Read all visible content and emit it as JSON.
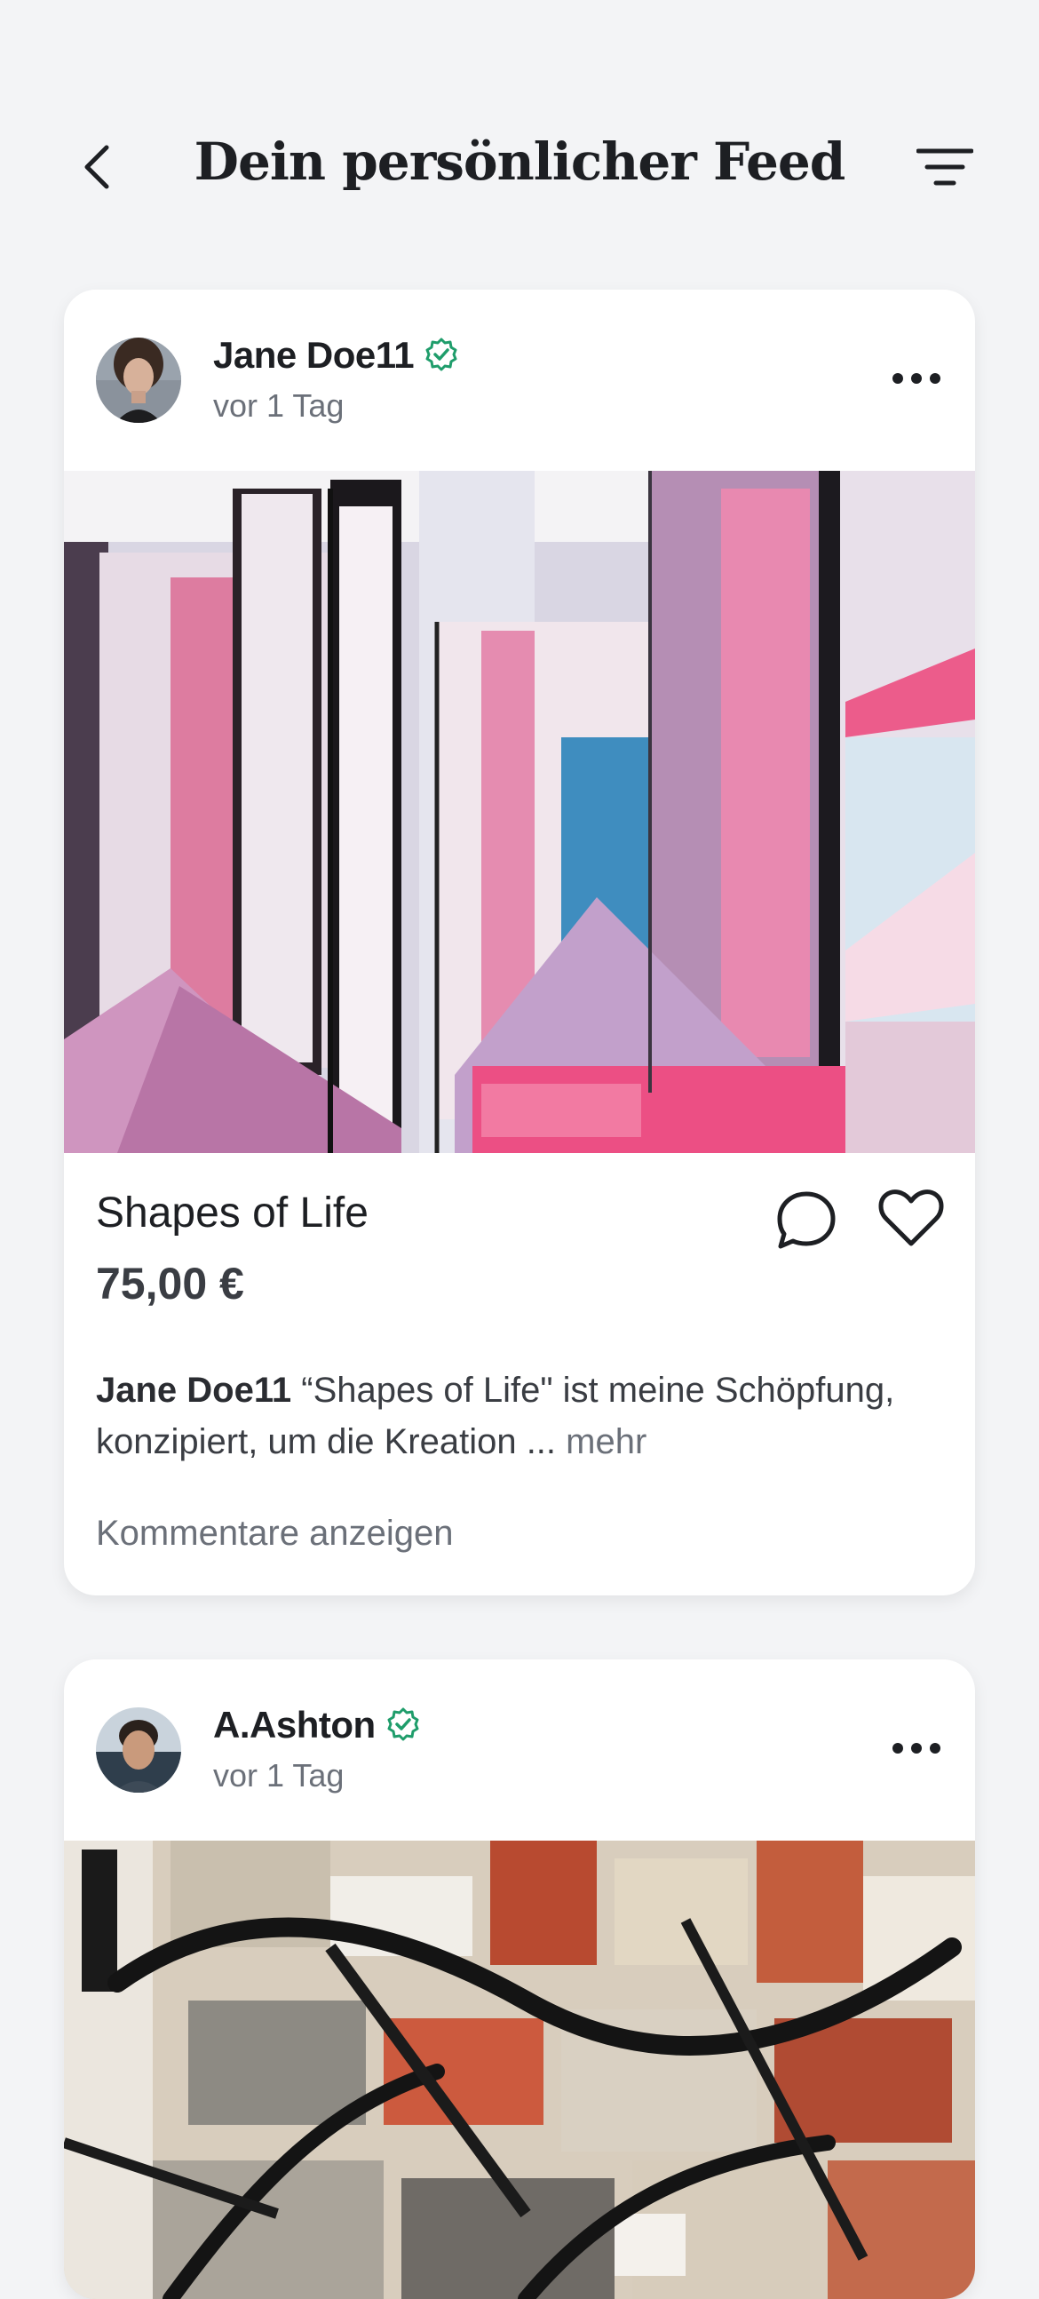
{
  "header": {
    "title": "Dein persönlicher Feed",
    "back_icon": "chevron-left-icon",
    "filter_icon": "filter-icon"
  },
  "colors": {
    "background": "#f3f4f6",
    "card": "#ffffff",
    "verified": "#1f9d6b",
    "text": "#1d1f23",
    "muted": "#6b7079"
  },
  "posts": [
    {
      "author": "Jane Doe11",
      "verified": true,
      "time": "vor 1 Tag",
      "title": "Shapes of Life",
      "price": "75,00 €",
      "caption_author": "Jane Doe11",
      "caption_text": "“Shapes of Life\" ist meine Schöpfung, konzipiert, um die Kreation ...",
      "more_label": "mehr",
      "comments_label": "Kommentare anzeigen"
    },
    {
      "author": "A.Ashton",
      "verified": true,
      "time": "vor 1 Tag"
    }
  ]
}
